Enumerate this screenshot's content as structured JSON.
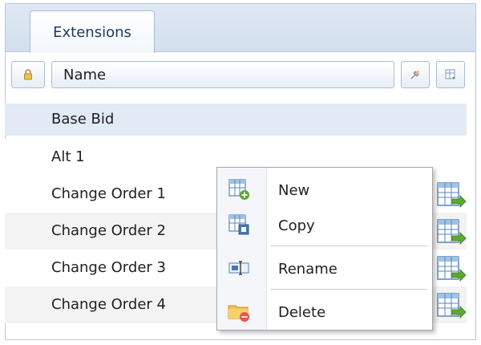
{
  "tabs": [
    {
      "label": "Extensions",
      "active": true
    }
  ],
  "header": {
    "lock_icon": "lock-icon",
    "name_label": "Name",
    "pin_icon": "pin-icon",
    "columns_icon": "column-chooser-icon"
  },
  "rows": [
    {
      "label": "Base Bid",
      "state": "selected"
    },
    {
      "label": "Alt 1"
    },
    {
      "label": "Change Order 1",
      "icon": "grid-export-icon"
    },
    {
      "label": "Change Order 2",
      "icon": "grid-export-icon"
    },
    {
      "label": "Change Order 3",
      "icon": "grid-export-icon"
    },
    {
      "label": "Change Order 4",
      "icon": "grid-export-icon"
    }
  ],
  "context_menu": {
    "items": [
      {
        "label": "New",
        "icon": "new-grid-icon"
      },
      {
        "label": "Copy",
        "icon": "copy-grid-icon"
      },
      {
        "label": "Rename",
        "icon": "rename-icon"
      },
      {
        "label": "Delete",
        "icon": "delete-folder-icon"
      }
    ]
  },
  "colors": {
    "accent": "#5b9bd5",
    "selection": "#e1eaf5",
    "export_arrow": "#5fa832",
    "delete_red": "#e8544a",
    "folder": "#f2c14e"
  }
}
